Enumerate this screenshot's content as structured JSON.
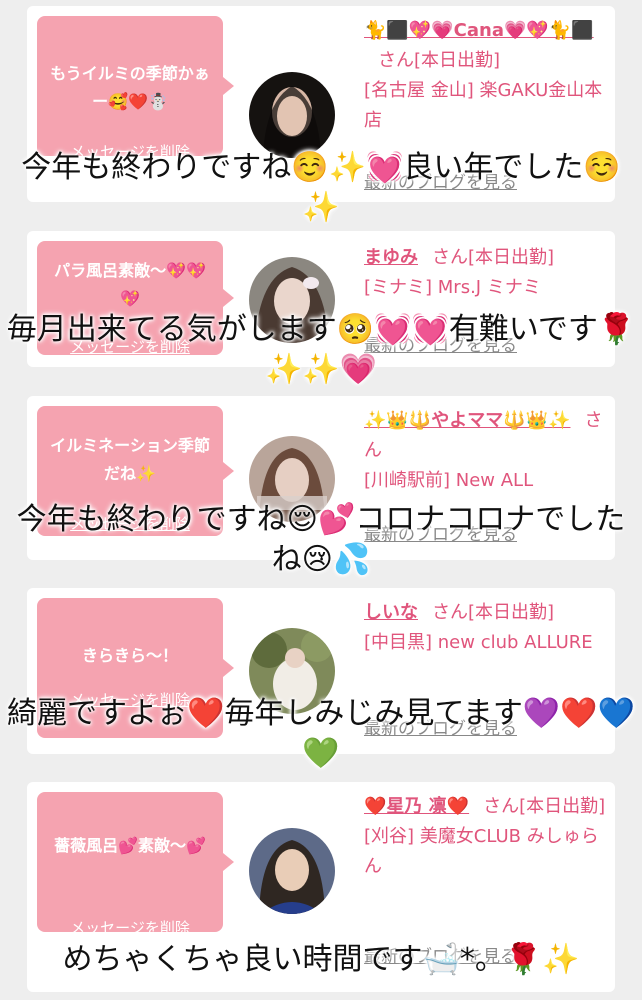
{
  "messages": [
    {
      "bubble": "もうイルミの季節かぁー🥰❤️☃️",
      "delete_label": "メッセージを削除",
      "name": "🐈⬛💖💗Cana💗💖🐈⬛",
      "san": "さん[本日出勤]",
      "shop": "[名古屋 金山] 楽GAKU金山本店",
      "blog_label": "最新のブログを見る",
      "overlay": "今年も終わりですね☺️✨💓良い年でした☺️✨"
    },
    {
      "bubble": "パラ風呂素敵〜💖💖💖",
      "delete_label": "メッセージを削除",
      "name": "まゆみ",
      "san": "さん[本日出勤]",
      "shop": "[ミナミ] Mrs.J ミナミ",
      "blog_label": "最新のブログを見る",
      "overlay": "毎月出来てる気がします🥺💓💓有難いです🌹✨✨💗"
    },
    {
      "bubble": "イルミネーション季節だね✨",
      "delete_label": "メッセージを削除",
      "name": "✨👑🔱やよママ🔱👑✨",
      "san": "さん",
      "shop": "[川崎駅前] New ALL",
      "blog_label": "最新のブログを見る",
      "overlay": "今年も終わりですね😌💕コロナコロナでしたね😢💦"
    },
    {
      "bubble": "きらきら〜！",
      "delete_label": "メッセージを削除",
      "name": "しいな",
      "san": "さん[本日出勤]",
      "shop": "[中目黒] new club ALLURE",
      "blog_label": "最新のブログを見る",
      "overlay": "綺麗ですよぉ❤️毎年しみじみ見てます💜❤️💙💚"
    },
    {
      "bubble": "薔薇風呂💕素敵〜💕",
      "delete_label": "メッセージを削除",
      "name": "❤️星乃 凛❤️",
      "san": "さん[本日出勤]",
      "shop": "[刈谷] 美魔女CLUB みしゅらん",
      "blog_label": "最新のブログを見る",
      "overlay": "めちゃくちゃ良い時間です🛁*。🌹✨"
    }
  ],
  "colors": {
    "page_bg": "#eeeeee",
    "bubble_bg": "#f5a3b0",
    "accent_text": "#e0557c",
    "link_gray": "#888888"
  }
}
